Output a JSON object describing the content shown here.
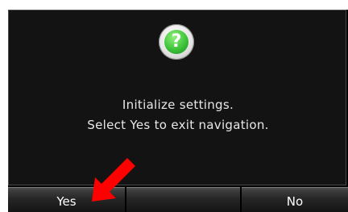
{
  "dialog": {
    "icon": "question-icon",
    "icon_glyph": "?",
    "message_line1": "Initialize settings.",
    "message_line2": "Select Yes to exit navigation."
  },
  "buttons": {
    "yes_label": "Yes",
    "middle_label": "",
    "no_label": "No"
  },
  "annotation": {
    "pointer": "red-arrow-icon",
    "color": "#ff0000"
  }
}
